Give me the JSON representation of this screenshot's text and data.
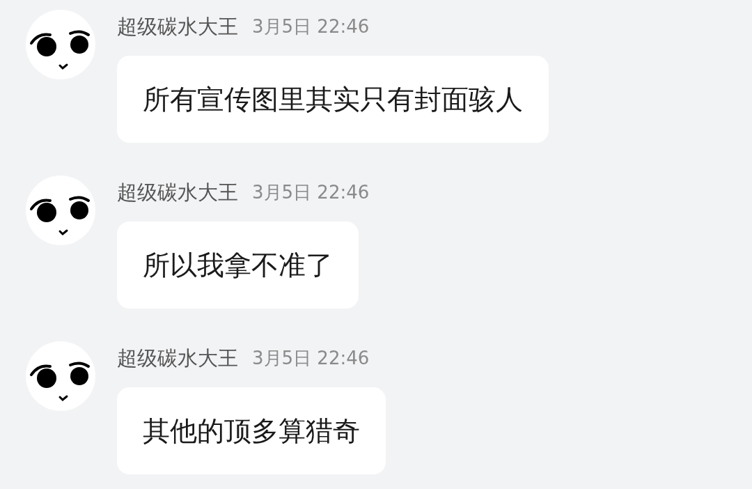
{
  "messages": [
    {
      "sender": "超级碳水大王",
      "time": "3月5日 22:46",
      "text": "所有宣传图里其实只有封面骇人"
    },
    {
      "sender": "超级碳水大王",
      "time": "3月5日 22:46",
      "text": "所以我拿不准了"
    },
    {
      "sender": "超级碳水大王",
      "time": "3月5日 22:46",
      "text": "其他的顶多算猎奇"
    }
  ]
}
